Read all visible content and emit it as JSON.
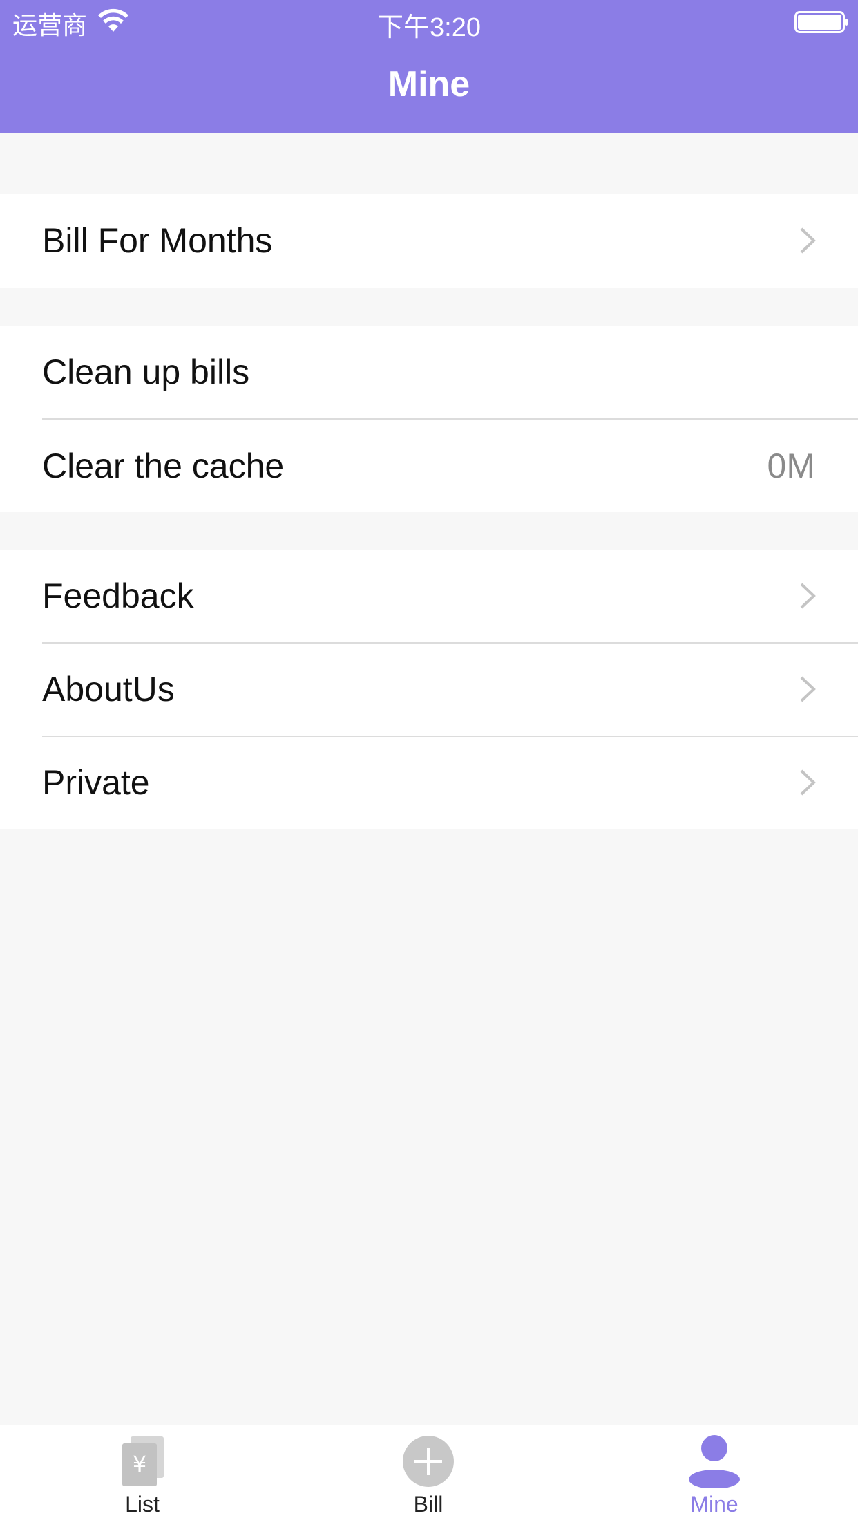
{
  "status_bar": {
    "carrier": "运营商",
    "time": "下午3:20"
  },
  "nav": {
    "title": "Mine"
  },
  "groups": [
    {
      "rows": [
        {
          "label": "Bill For Months",
          "chevron": true
        }
      ]
    },
    {
      "rows": [
        {
          "label": "Clean up bills",
          "chevron": false
        },
        {
          "label": "Clear the cache",
          "value": "0M",
          "chevron": false
        }
      ]
    },
    {
      "rows": [
        {
          "label": "Feedback",
          "chevron": true
        },
        {
          "label": "AboutUs",
          "chevron": true
        },
        {
          "label": "Private",
          "chevron": true
        }
      ]
    }
  ],
  "tabbar": {
    "tabs": [
      {
        "label": "List",
        "icon": "bill-list-icon",
        "active": false
      },
      {
        "label": "Bill",
        "icon": "add-circle-icon",
        "active": false
      },
      {
        "label": "Mine",
        "icon": "user-icon",
        "active": true
      }
    ]
  },
  "colors": {
    "accent": "#8b7de6",
    "background": "#f7f7f7",
    "icon_gray": "#c8c8c8"
  }
}
